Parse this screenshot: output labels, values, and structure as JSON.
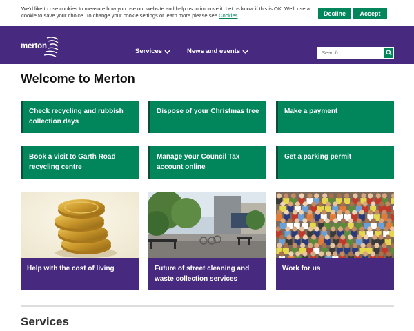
{
  "cookie_banner": {
    "text": "We'd like to use cookies to measure how you use our website and help us to improve it. Let us know if this is OK. We'll use a cookie to save your choice. To change your cookie settings or learn more please see ",
    "link_text": "Cookies",
    "decline_label": "Decline",
    "accept_label": "Accept"
  },
  "header": {
    "logo_text": "merton",
    "nav": [
      {
        "label": "Services"
      },
      {
        "label": "News and events"
      }
    ],
    "search_placeholder": "Search"
  },
  "main": {
    "title": "Welcome to Merton",
    "quick_links": [
      {
        "label": "Check recycling and rubbish collection days"
      },
      {
        "label": "Dispose of your Christmas tree"
      },
      {
        "label": "Make a payment"
      },
      {
        "label": "Book a visit to Garth Road recycling centre"
      },
      {
        "label": "Manage your Council Tax account online"
      },
      {
        "label": "Get a parking permit"
      }
    ],
    "features": [
      {
        "label": "Help with the cost of living",
        "image": "gold-coins-image"
      },
      {
        "label": "Future of street cleaning and waste collection services",
        "image": "street-scene-image"
      },
      {
        "label": "Work for us",
        "image": "crowd-of-people-image"
      }
    ],
    "services_heading": "Services"
  },
  "colors": {
    "brand_purple": "#472a80",
    "brand_green": "#00865a",
    "green_border": "#0b4f3a"
  }
}
